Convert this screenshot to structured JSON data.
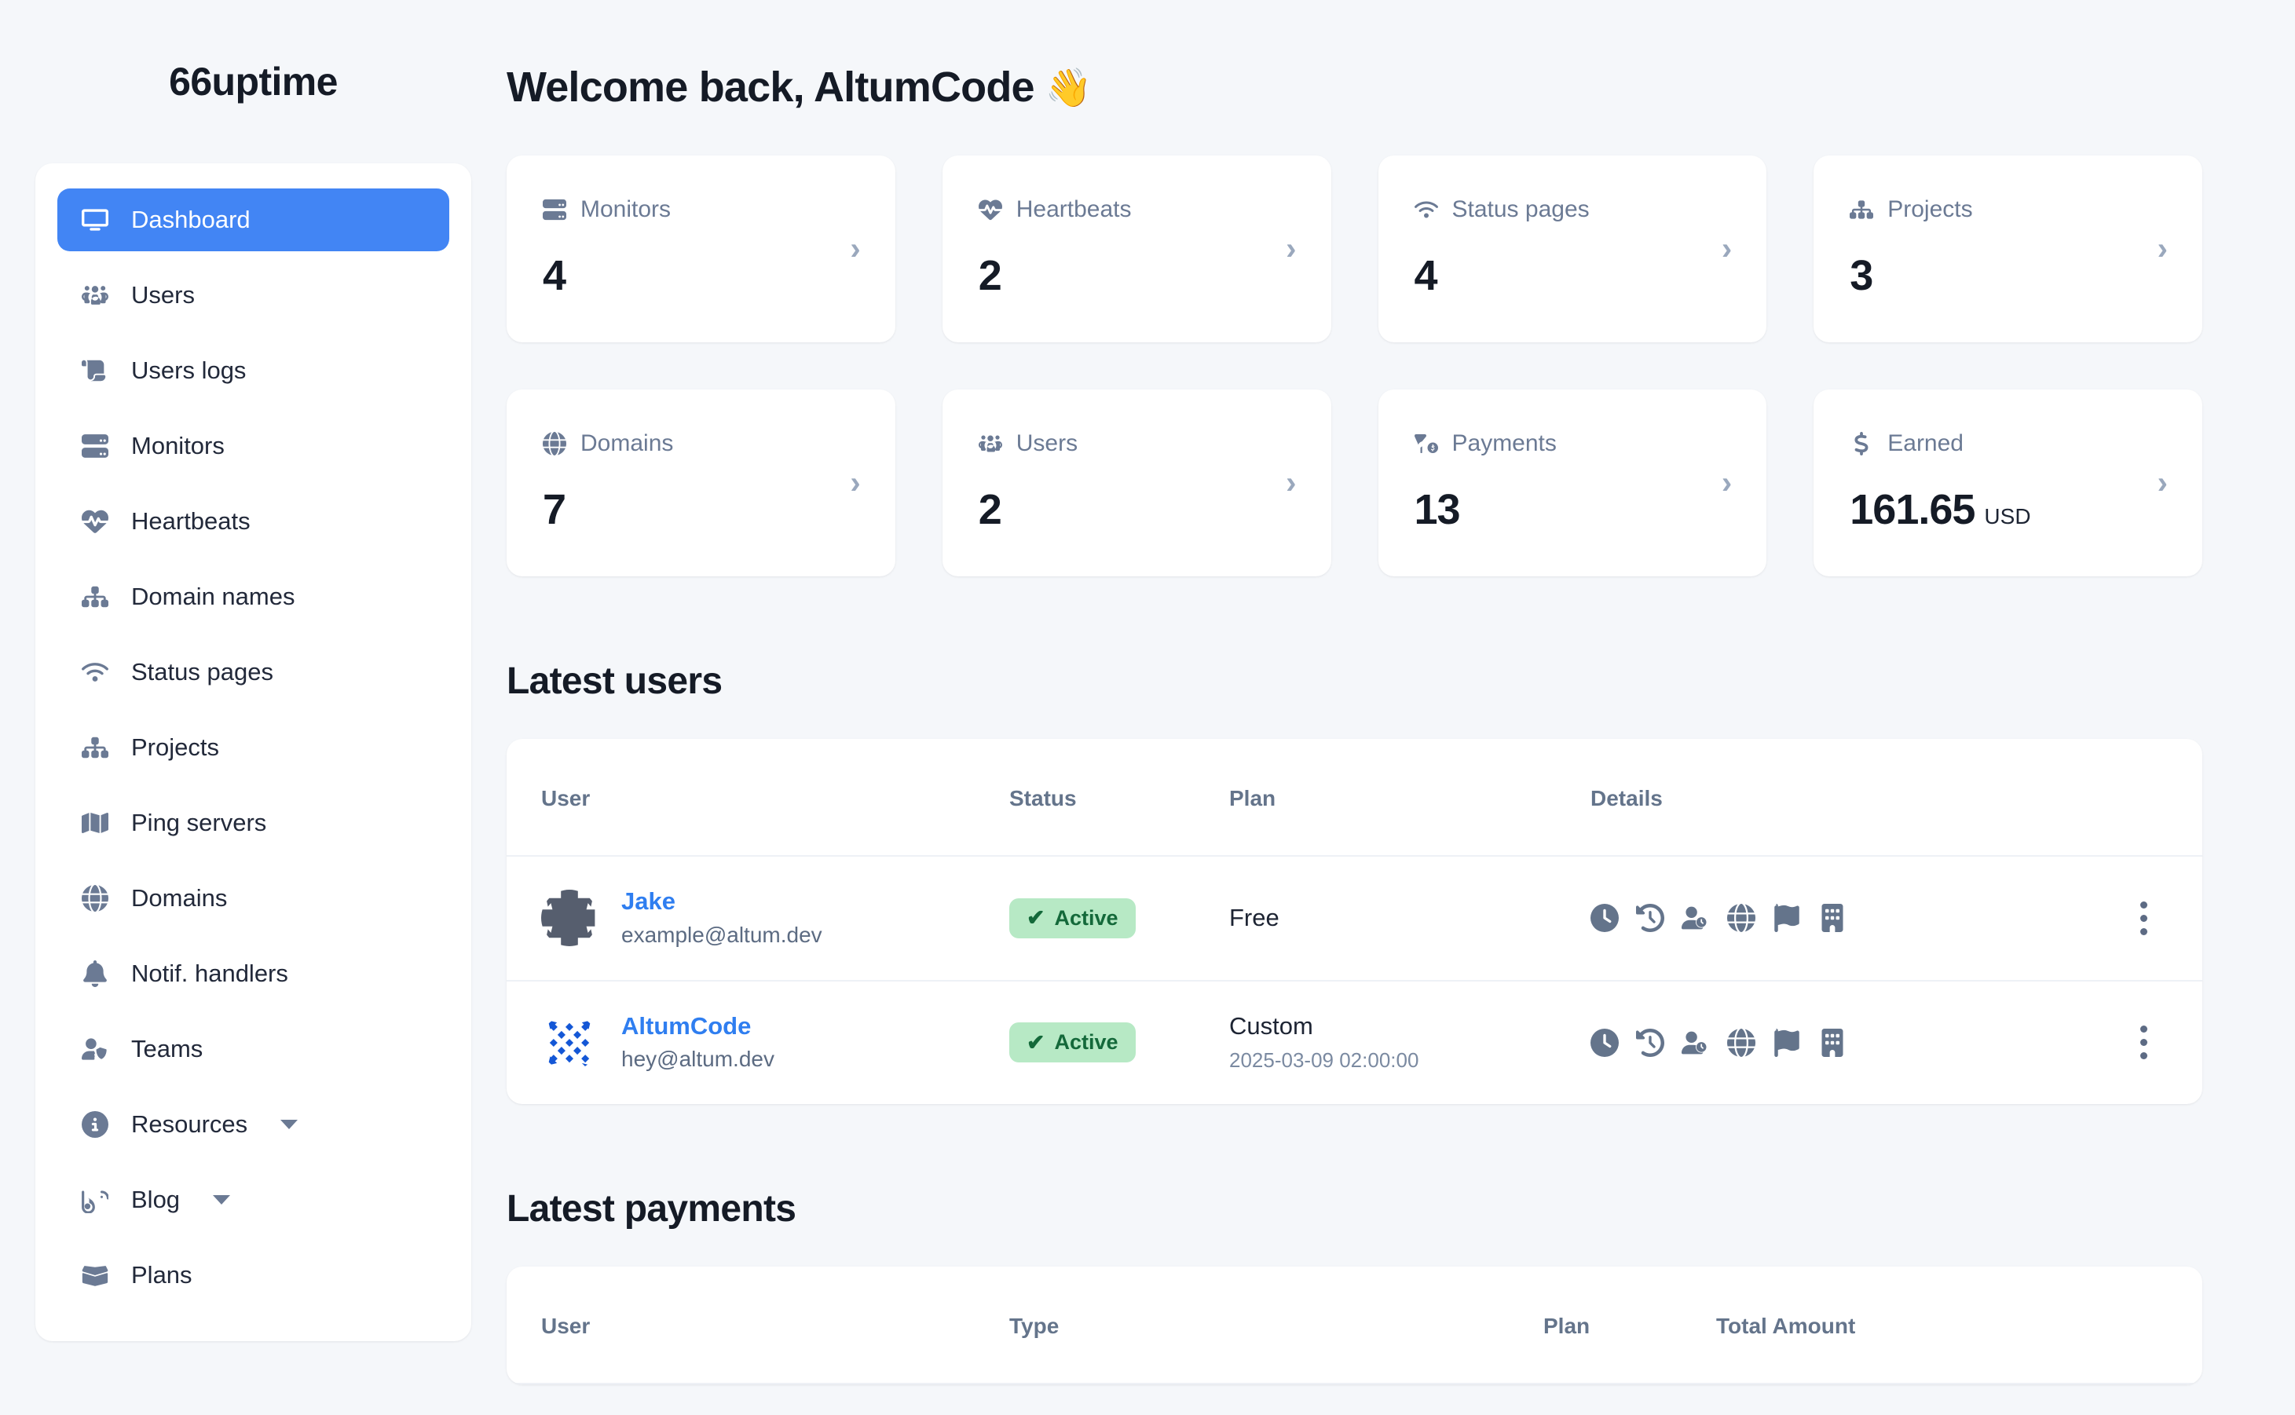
{
  "brand": {
    "name": "66uptime"
  },
  "sidebar": {
    "items": [
      {
        "label": "Dashboard",
        "icon": "monitor-icon",
        "active": true,
        "caret": false
      },
      {
        "label": "Users",
        "icon": "users-group-icon",
        "active": false,
        "caret": false
      },
      {
        "label": "Users logs",
        "icon": "scroll-icon",
        "active": false,
        "caret": false
      },
      {
        "label": "Monitors",
        "icon": "server-icon",
        "active": false,
        "caret": false
      },
      {
        "label": "Heartbeats",
        "icon": "heartbeat-icon",
        "active": false,
        "caret": false
      },
      {
        "label": "Domain names",
        "icon": "sitemap-icon",
        "active": false,
        "caret": false
      },
      {
        "label": "Status pages",
        "icon": "wifi-icon",
        "active": false,
        "caret": false
      },
      {
        "label": "Projects",
        "icon": "project-tree-icon",
        "active": false,
        "caret": false
      },
      {
        "label": "Ping servers",
        "icon": "map-pin-icon",
        "active": false,
        "caret": false
      },
      {
        "label": "Domains",
        "icon": "globe-icon",
        "active": false,
        "caret": false
      },
      {
        "label": "Notif. handlers",
        "icon": "bell-icon",
        "active": false,
        "caret": false
      },
      {
        "label": "Teams",
        "icon": "user-shield-icon",
        "active": false,
        "caret": false
      },
      {
        "label": "Resources",
        "icon": "info-circle-icon",
        "active": false,
        "caret": true
      },
      {
        "label": "Blog",
        "icon": "blog-icon",
        "active": false,
        "caret": true
      },
      {
        "label": "Plans",
        "icon": "open-box-icon",
        "active": false,
        "caret": false
      }
    ]
  },
  "header": {
    "greeting": "Welcome back, AltumCode",
    "wave_emoji": "👋"
  },
  "stats": [
    {
      "label": "Monitors",
      "icon": "server-icon",
      "value": "4",
      "suffix": ""
    },
    {
      "label": "Heartbeats",
      "icon": "heartbeat-icon",
      "value": "2",
      "suffix": ""
    },
    {
      "label": "Status pages",
      "icon": "wifi-icon",
      "value": "4",
      "suffix": ""
    },
    {
      "label": "Projects",
      "icon": "project-tree-icon",
      "value": "3",
      "suffix": ""
    },
    {
      "label": "Domains",
      "icon": "globe-icon",
      "value": "7",
      "suffix": ""
    },
    {
      "label": "Users",
      "icon": "users-group-icon",
      "value": "2",
      "suffix": ""
    },
    {
      "label": "Payments",
      "icon": "funnel-dollar-icon",
      "value": "13",
      "suffix": ""
    },
    {
      "label": "Earned",
      "icon": "dollar-icon",
      "value": "161.65",
      "suffix": "USD"
    }
  ],
  "latest_users": {
    "title": "Latest users",
    "columns": [
      "User",
      "Status",
      "Plan",
      "Details"
    ],
    "rows": [
      {
        "name": "Jake",
        "email": "example@altum.dev",
        "avatar": "identicon-dark-star",
        "status": "Active",
        "status_tick": "✔",
        "plan": "Free",
        "plan_date": "",
        "details_icons": [
          "clock-icon",
          "history-icon",
          "user-clock-icon",
          "globe-icon",
          "flag-icon",
          "building-icon"
        ]
      },
      {
        "name": "AltumCode",
        "email": "hey@altum.dev",
        "avatar": "identicon-blue-diamond",
        "status": "Active",
        "status_tick": "✔",
        "plan": "Custom",
        "plan_date": "2025-03-09 02:00:00",
        "details_icons": [
          "clock-icon",
          "history-icon",
          "user-clock-icon",
          "globe-icon",
          "flag-icon",
          "building-icon"
        ]
      }
    ]
  },
  "latest_payments": {
    "title": "Latest payments",
    "columns": [
      "User",
      "Type",
      "Plan",
      "Total Amount"
    ]
  },
  "colors": {
    "accent": "#4285f4",
    "page_bg": "#f5f7fa",
    "card_bg": "#ffffff",
    "text_primary": "#151b26",
    "text_muted": "#6b7a94",
    "link": "#2f7ef0",
    "badge_bg": "#b7e9c5",
    "badge_text": "#14693a"
  }
}
